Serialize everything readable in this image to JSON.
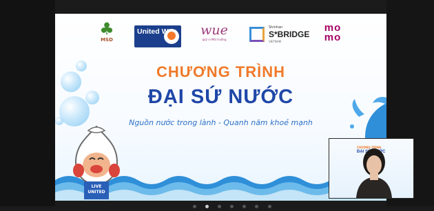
{
  "logos": {
    "msd": "MSD",
    "united_way": "United Way",
    "wue": "wue",
    "wue_tagline": "quỹ vì Môi trường",
    "shinhan_small": "Shinhan",
    "shinhan_big": "S*BRIDGE",
    "shinhan_country": "VIETNAM",
    "momo": "mo mo"
  },
  "slide": {
    "title_line1": "CHƯƠNG TRÌNH",
    "title_line2": "ĐẠI SỨ NƯỚC",
    "subtitle": "Nguồn nước trong lành - Quanh năm khoẻ mạnh",
    "mascot_label": "LIVE UNITED"
  },
  "pip": {
    "mini_title1": "CHƯƠNG TRÌNH",
    "mini_title2": "ĐẠI SỨ NƯỚC"
  },
  "pager": {
    "count": 7,
    "active": 1
  },
  "colors": {
    "title_orange": "#f07a2a",
    "title_blue": "#1f47a8",
    "subtitle_blue": "#2b6fc7",
    "water_blue": "#2f8fd8"
  }
}
